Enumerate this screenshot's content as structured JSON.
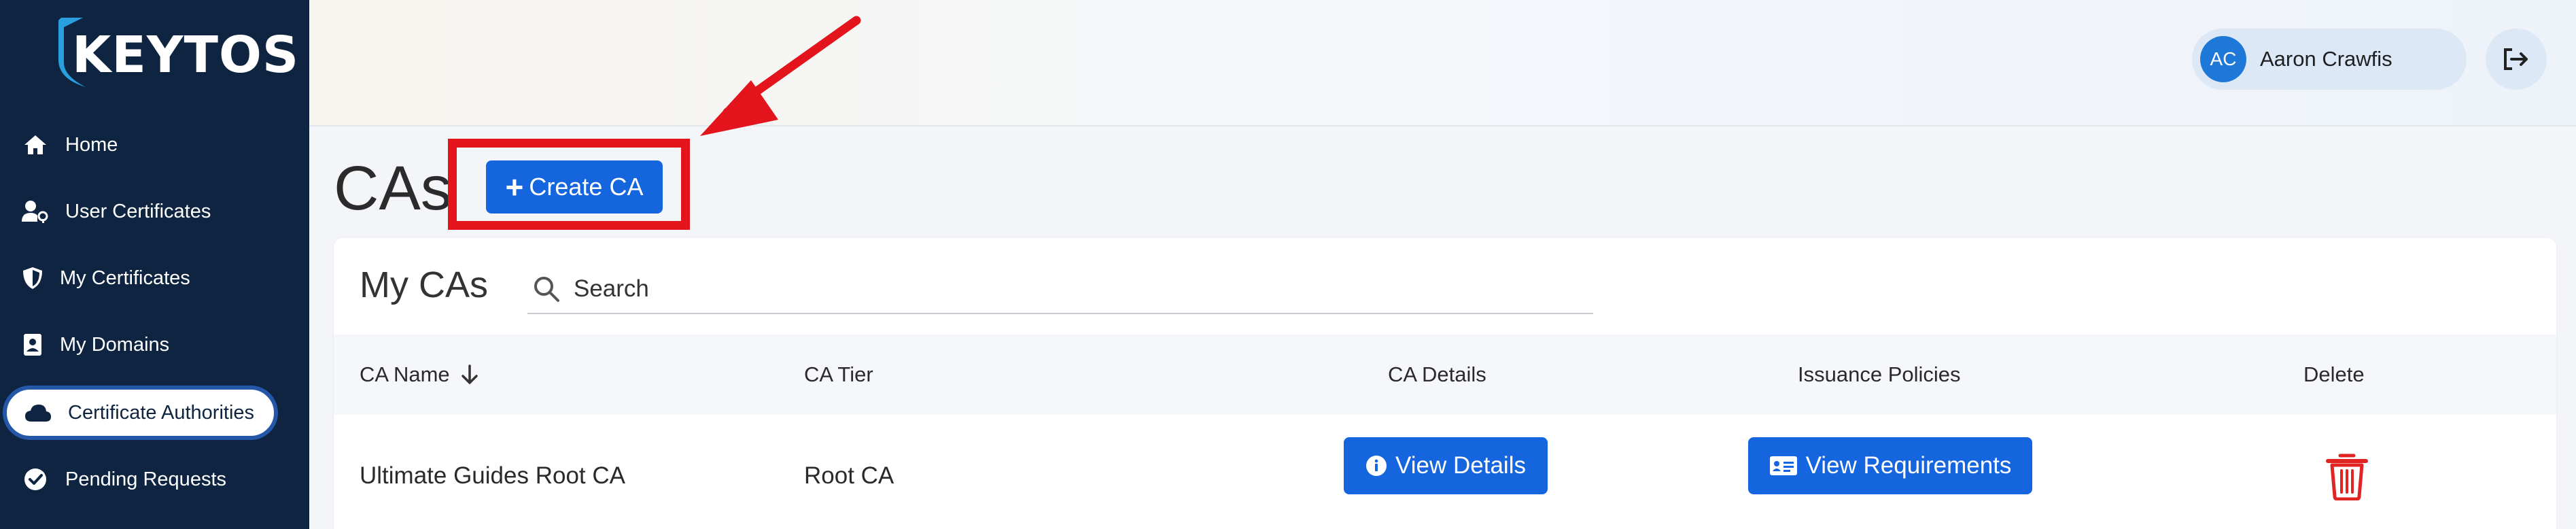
{
  "brand": {
    "name": "KEYTOS",
    "accent": "#2a9fe0"
  },
  "sidebar": {
    "items": [
      {
        "label": "Home",
        "icon": "home-icon"
      },
      {
        "label": "User Certificates",
        "icon": "user-key-icon"
      },
      {
        "label": "My Certificates",
        "icon": "shield-icon"
      },
      {
        "label": "My Domains",
        "icon": "contact-card-icon"
      },
      {
        "label": "Certificate Authorities",
        "icon": "cloud-icon",
        "active": true
      },
      {
        "label": "Pending Requests",
        "icon": "check-circle-icon"
      }
    ]
  },
  "user": {
    "initials": "AC",
    "name": "Aaron Crawfis"
  },
  "page": {
    "title": "CAs",
    "create_button": "Create CA"
  },
  "card": {
    "title": "My CAs",
    "search_placeholder": "Search",
    "columns": [
      "CA Name",
      "CA Tier",
      "CA Details",
      "Issuance Policies",
      "Delete"
    ],
    "rows": [
      {
        "name": "Ultimate Guides Root CA",
        "tier": "Root CA",
        "details_button": "View Details",
        "policies_button": "View Requirements"
      }
    ]
  },
  "colors": {
    "sidebar_bg": "#0e2440",
    "primary": "#1565de",
    "annotation": "#e3141b",
    "delete": "#e02424"
  }
}
